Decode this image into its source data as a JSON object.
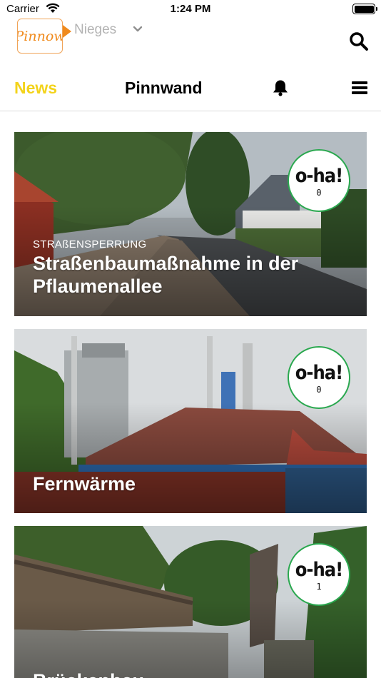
{
  "status_bar": {
    "carrier": "Carrier",
    "time": "1:24 PM"
  },
  "header": {
    "logo_text": "Pinnow",
    "location": "Nieges"
  },
  "nav": {
    "tab_news": "News",
    "tab_pinnwand": "Pinnwand"
  },
  "colors": {
    "accent_news": "#f3d31b",
    "badge_ring": "#2aa84f",
    "logo_orange": "#f08a1c"
  },
  "cards": [
    {
      "category": "STRAßENSPERRUNG",
      "title": "Straßenbaumaßnahme in der Pflaumenallee",
      "badge_text": "o-ha!",
      "badge_count": "0"
    },
    {
      "category": "",
      "title": "Fernwärme",
      "badge_text": "o-ha!",
      "badge_count": "0"
    },
    {
      "category": "",
      "title": "Brückenbau",
      "badge_text": "o-ha!",
      "badge_count": "1"
    }
  ]
}
